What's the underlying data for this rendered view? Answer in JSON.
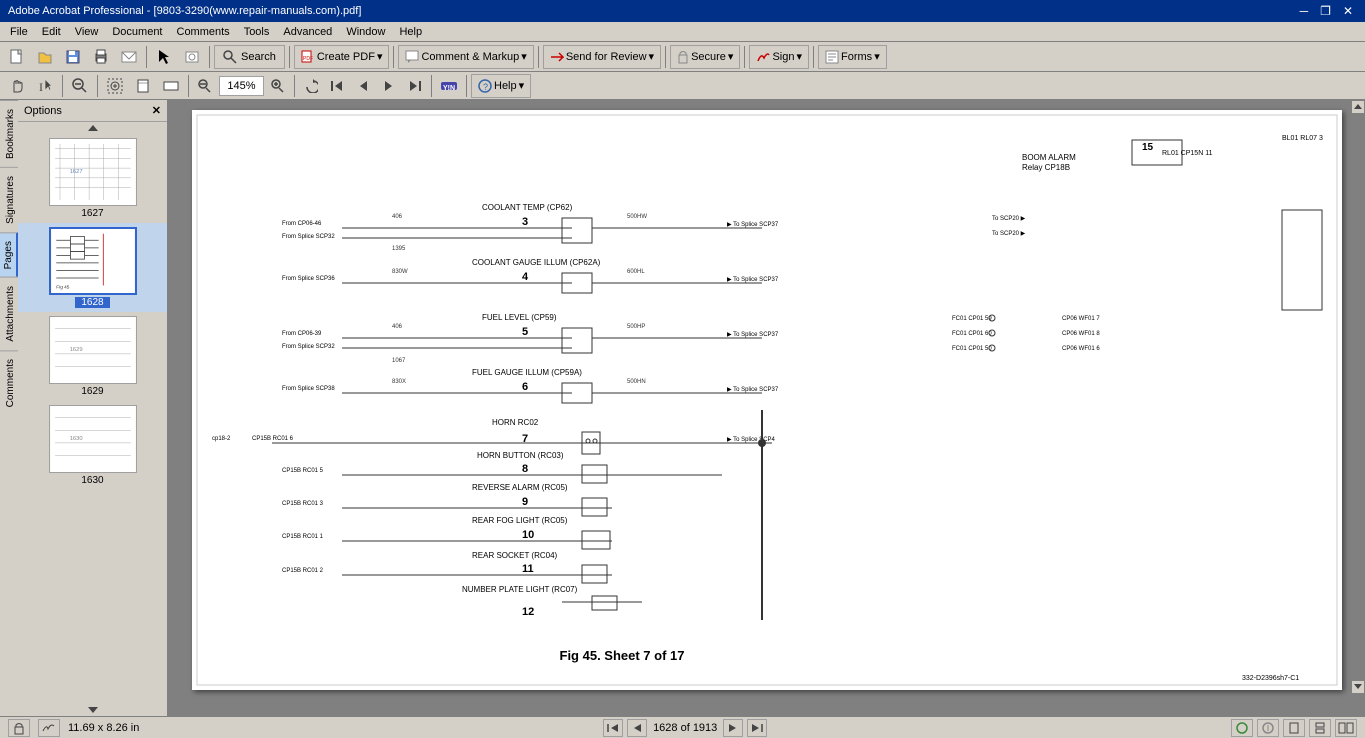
{
  "titlebar": {
    "title": "Adobe Acrobat Professional - [9803-3290(www.repair-manuals.com).pdf]",
    "controls": [
      "_",
      "□",
      "✕"
    ]
  },
  "menubar": {
    "items": [
      "File",
      "Edit",
      "View",
      "Document",
      "Comments",
      "Tools",
      "Advanced",
      "Window",
      "Help"
    ]
  },
  "toolbar1": {
    "buttons": [
      "new",
      "open",
      "save",
      "print",
      "email",
      "select"
    ],
    "search_label": "Search",
    "create_pdf_label": "Create PDF",
    "comment_markup_label": "Comment & Markup",
    "send_review_label": "Send for Review",
    "secure_label": "Secure",
    "sign_label": "Sign",
    "forms_label": "Forms"
  },
  "toolbar2": {
    "zoom_value": "145%",
    "help_label": "Help"
  },
  "panel": {
    "options_label": "Options",
    "tabs": [
      "Bookmarks",
      "Signatures",
      "Pages",
      "Attachments",
      "Comments"
    ],
    "thumbnails": [
      {
        "num": "1627",
        "selected": false
      },
      {
        "num": "1628",
        "selected": true
      },
      {
        "num": "1629",
        "selected": false
      },
      {
        "num": "1630",
        "selected": false
      }
    ]
  },
  "page": {
    "title": "Fig 45. Sheet 7 of 17",
    "reference": "332-D2396sh7-C1",
    "dimensions": "11.69 x 8.26 in"
  },
  "statusbar": {
    "dimensions": "11.69 x 8.26 in",
    "page_current": "1628 of",
    "page_total": "1913",
    "page_display": "1628 of 1913"
  }
}
